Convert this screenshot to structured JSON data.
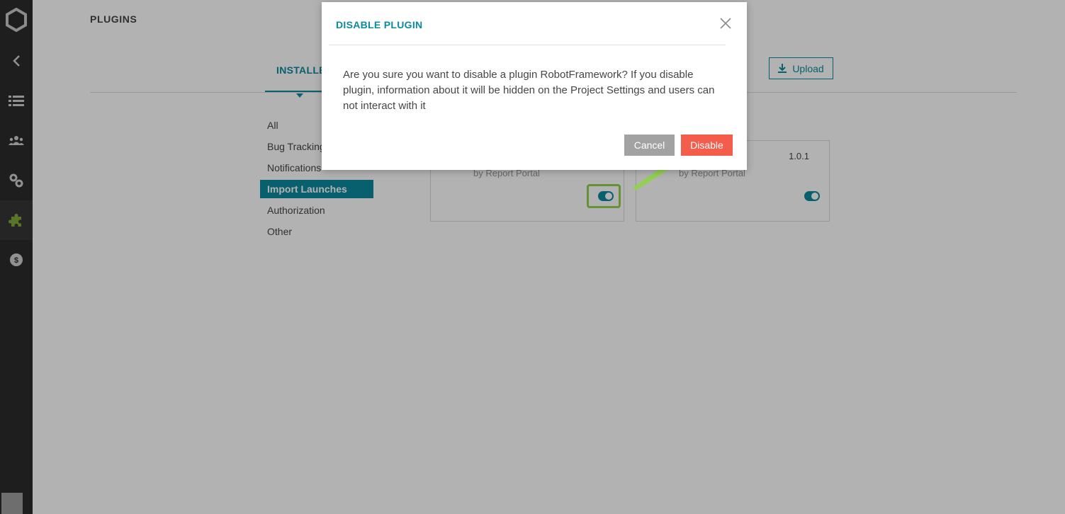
{
  "page": {
    "title": "PLUGINS"
  },
  "tabs": [
    {
      "label": "INSTALLED"
    }
  ],
  "toolbar": {
    "upload_label": "Upload"
  },
  "filters": [
    {
      "label": "All",
      "active": false
    },
    {
      "label": "Bug Tracking",
      "active": false
    },
    {
      "label": "Notifications",
      "active": false
    },
    {
      "label": "Import Launches",
      "active": true
    },
    {
      "label": "Authorization",
      "active": false
    },
    {
      "label": "Other",
      "active": false
    }
  ],
  "cards": [
    {
      "author": "by Report Portal",
      "version": "",
      "enabled": true
    },
    {
      "author": "by Report Portal",
      "version": "1.0.1",
      "enabled": true
    }
  ],
  "modal": {
    "title": "DISABLE PLUGIN",
    "message": "Are you sure you want to disable a plugin RobotFramework? If you disable plugin, information about it will be hidden on the Project Settings and users can not interact with it",
    "cancel_label": "Cancel",
    "confirm_label": "Disable"
  },
  "colors": {
    "accent": "#0c8a9e",
    "danger": "#f45c4c",
    "sidebar": "#2c2c2c",
    "highlight": "#92d14f"
  }
}
